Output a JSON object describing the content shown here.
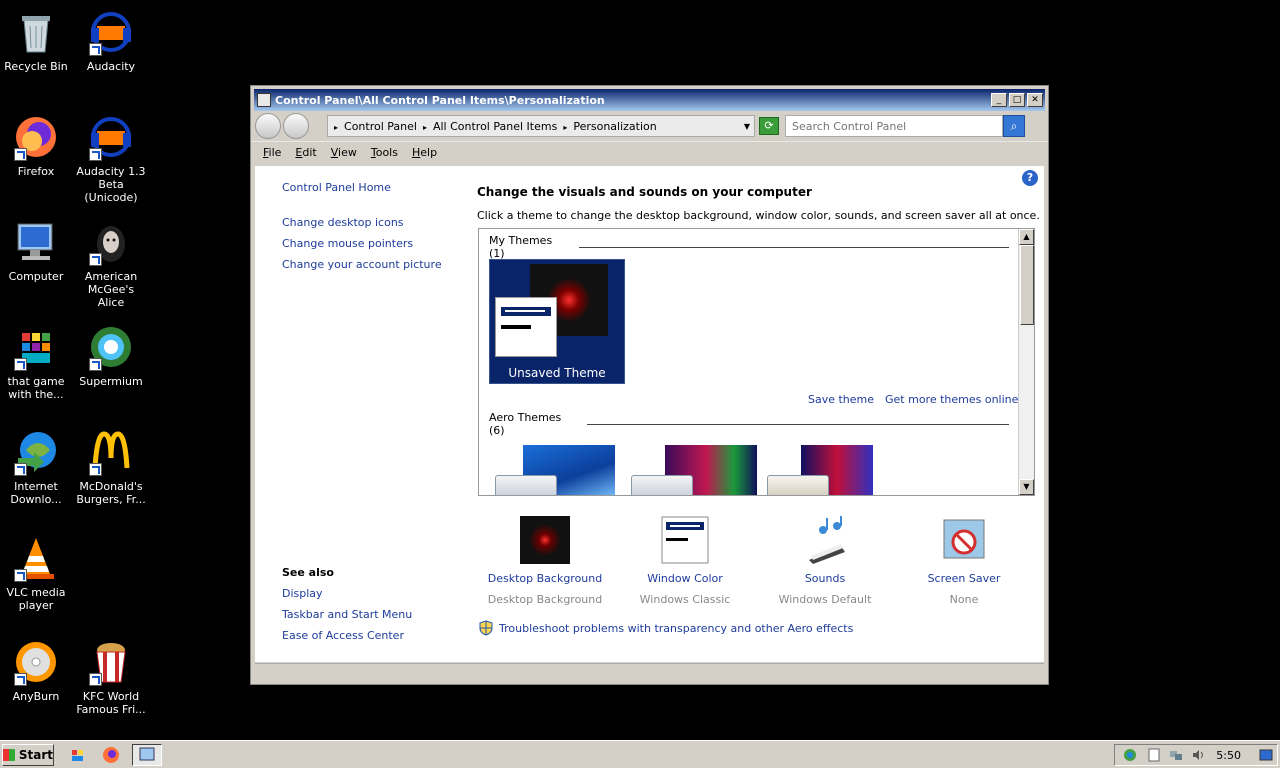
{
  "desktop": {
    "icons": [
      {
        "label": "Recycle Bin"
      },
      {
        "label": "Audacity"
      },
      {
        "label": "Firefox"
      },
      {
        "label": "Audacity 1.3 Beta (Unicode)"
      },
      {
        "label": "Computer"
      },
      {
        "label": "American McGee's Alice"
      },
      {
        "label": "that game with the..."
      },
      {
        "label": "Supermium"
      },
      {
        "label": "Internet Downlo..."
      },
      {
        "label": "McDonald's Burgers, Fr..."
      },
      {
        "label": "VLC media player"
      },
      {
        "label": "AnyBurn"
      },
      {
        "label": "KFC World Famous Fri..."
      }
    ]
  },
  "window": {
    "title": "Control Panel\\All Control Panel Items\\Personalization",
    "address": [
      "Control Panel",
      "All Control Panel Items",
      "Personalization"
    ],
    "search_placeholder": "Search Control Panel",
    "menu": [
      "File",
      "Edit",
      "View",
      "Tools",
      "Help"
    ],
    "left_links": [
      "Control Panel Home",
      "Change desktop icons",
      "Change mouse pointers",
      "Change your account picture"
    ],
    "see_also_title": "See also",
    "see_also": [
      "Display",
      "Taskbar and Start Menu",
      "Ease of Access Center"
    ],
    "heading": "Change the visuals and sounds on your computer",
    "subheading": "Click a theme to change the desktop background, window color, sounds, and screen saver all at once.",
    "my_themes": "My Themes (1)",
    "unsaved_theme": "Unsaved Theme",
    "save_theme": "Save theme",
    "get_more": "Get more themes online",
    "aero_themes": "Aero Themes (6)",
    "bottom_items": [
      {
        "label": "Desktop Background",
        "value": "Desktop Background"
      },
      {
        "label": "Window Color",
        "value": "Windows Classic"
      },
      {
        "label": "Sounds",
        "value": "Windows Default"
      },
      {
        "label": "Screen Saver",
        "value": "None"
      }
    ],
    "troubleshoot": "Troubleshoot problems with transparency and other Aero effects"
  },
  "taskbar": {
    "start": "Start",
    "clock": "5:50"
  },
  "colors": {
    "link": "#1e3c9b",
    "titlebar": "#0a246a",
    "selected_theme": "#0a246a"
  }
}
